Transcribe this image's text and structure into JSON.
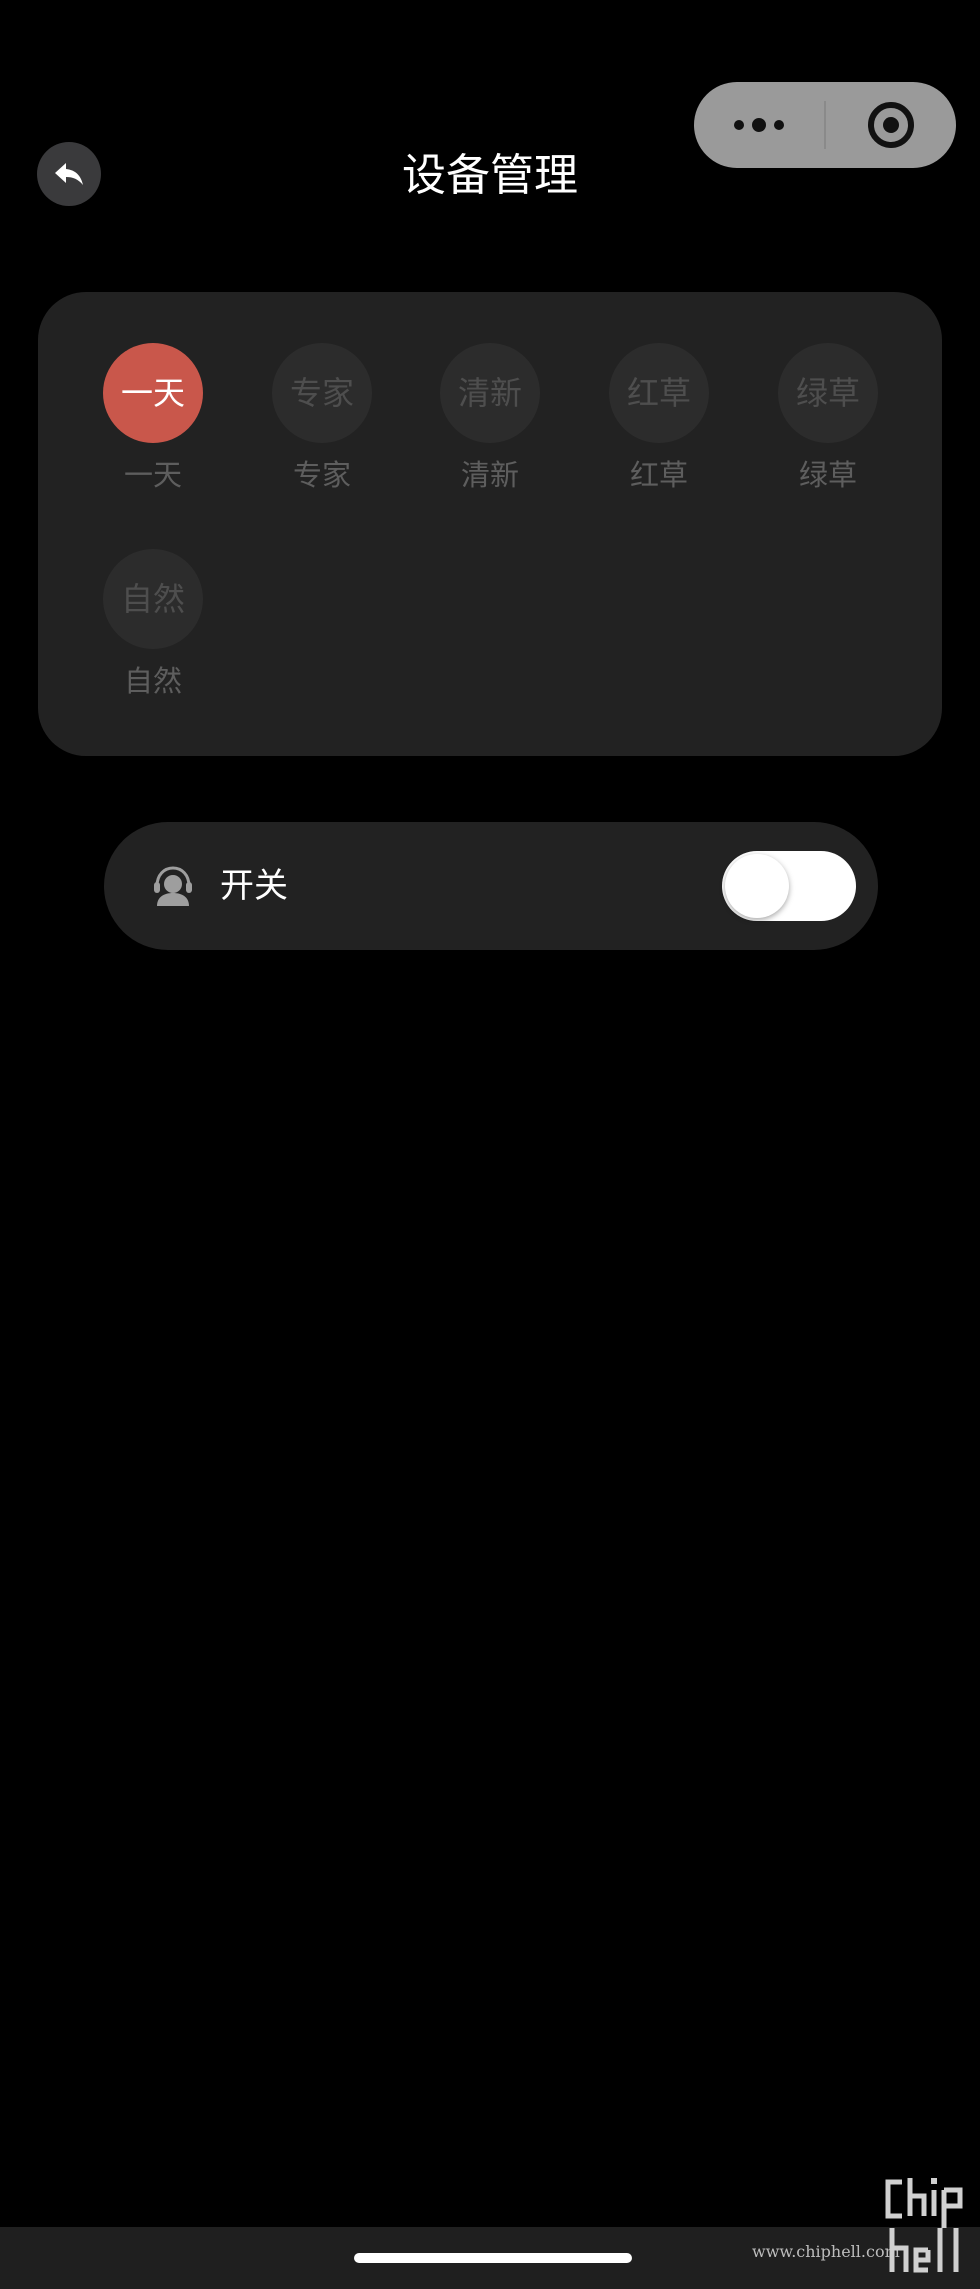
{
  "header": {
    "title": "设备管理",
    "back_icon": "back-arrow-icon"
  },
  "capsule": {
    "more_icon": "more-dots-icon",
    "close_icon": "target-close-icon"
  },
  "modes": {
    "selected": 0,
    "items": [
      {
        "icon_text": "一天",
        "label": "一天"
      },
      {
        "icon_text": "专家",
        "label": "专家"
      },
      {
        "icon_text": "清新",
        "label": "清新"
      },
      {
        "icon_text": "红草",
        "label": "红草"
      },
      {
        "icon_text": "绿草",
        "label": "绿草"
      },
      {
        "icon_text": "自然",
        "label": "自然"
      }
    ]
  },
  "power": {
    "label": "开关",
    "icon": "headset-user-icon",
    "on": false
  },
  "watermark": {
    "url": "www.chiphell.com",
    "logo_text": "chiphell"
  },
  "colors": {
    "accent": "#c9574b",
    "card": "#222222",
    "inactive_text": "#5e5e5e"
  }
}
